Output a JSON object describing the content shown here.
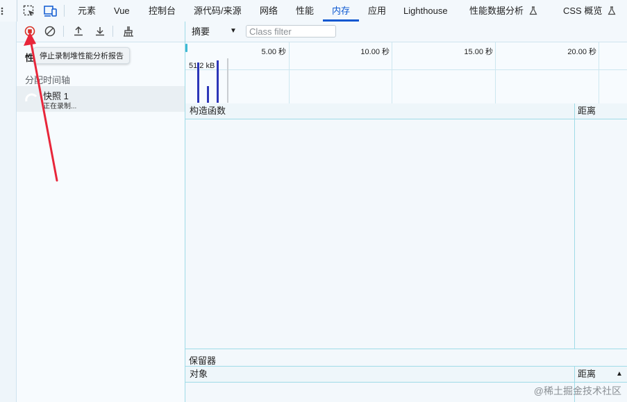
{
  "tabs": [
    {
      "label": "元素"
    },
    {
      "label": "Vue"
    },
    {
      "label": "控制台"
    },
    {
      "label": "源代码/来源"
    },
    {
      "label": "网络"
    },
    {
      "label": "性能"
    },
    {
      "label": "内存"
    },
    {
      "label": "应用"
    },
    {
      "label": "Lighthouse"
    },
    {
      "label": "性能数据分析"
    },
    {
      "label": "CSS 概览"
    }
  ],
  "toolbar": {
    "tooltip": "停止录制堆性能分析报告"
  },
  "left": {
    "profiles_heading": "性",
    "section_label": "分配时间轴",
    "snapshot_title": "快照 1",
    "snapshot_status": "正在录制..."
  },
  "right_toolbar": {
    "view_select": "摘要",
    "class_filter_placeholder": "Class filter"
  },
  "timeline": {
    "tick_labels": [
      "5.00 秒",
      "10.00 秒",
      "15.00 秒",
      "20.00 秒"
    ],
    "size_label": "51.2 kB",
    "bars": [
      0.95,
      0.4,
      1.0
    ]
  },
  "constructor_table": {
    "col_constructor": "构造函数",
    "col_distance": "距离"
  },
  "retainers": {
    "title": "保留器",
    "col_object": "对象",
    "col_distance": "距离",
    "sort_indicator": "▲"
  },
  "watermark": "@稀土掘金技术社区",
  "colors": {
    "accent": "#0b57d0",
    "record_red": "#d93025",
    "bar_blue": "#2c36b8",
    "border_cyan": "#9fdbe7",
    "arrow_red": "#e8263a"
  }
}
